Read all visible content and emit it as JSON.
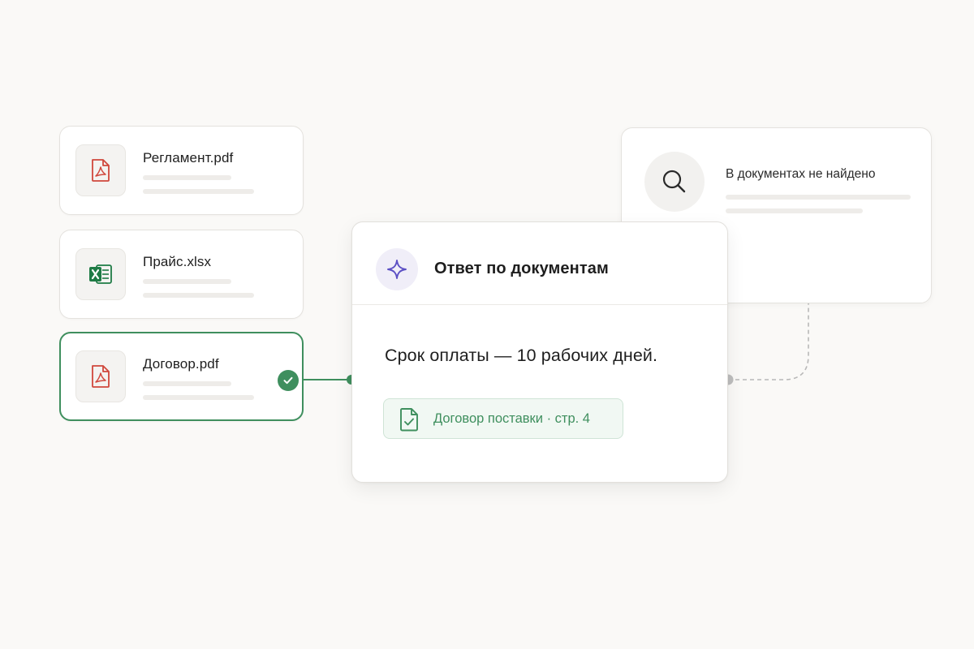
{
  "files": [
    {
      "name": "Регламент.pdf",
      "icon": "pdf-icon",
      "selected": false
    },
    {
      "name": "Прайс.xlsx",
      "icon": "excel-icon",
      "selected": false
    },
    {
      "name": "Договор.pdf",
      "icon": "pdf-icon",
      "selected": true
    }
  ],
  "not_found": {
    "title": "В документах не найдено",
    "icon": "search-icon"
  },
  "answer": {
    "title": "Ответ по документам",
    "icon": "sparkle-icon",
    "text": "Срок оплаты — 10 рабочих дней.",
    "source": {
      "label": "Договор поставки · стр. 4",
      "icon": "document-check-icon"
    }
  },
  "colors": {
    "accent_green": "#3f8f5e",
    "pdf_red": "#d0473c",
    "excel_green": "#1e7b45",
    "sparkle_purple": "#5b4fc4",
    "background": "#faf9f7"
  }
}
